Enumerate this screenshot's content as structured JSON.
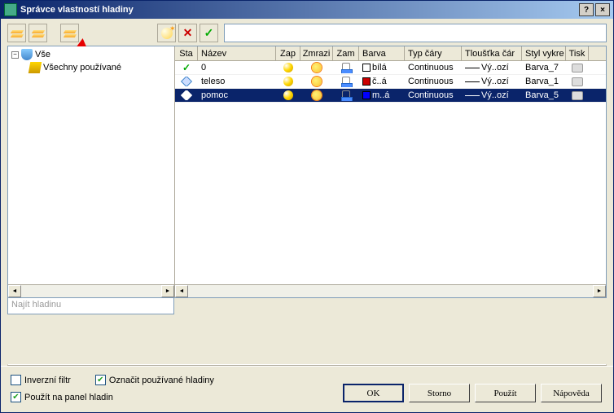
{
  "title": "Správce vlastností hladiny",
  "tree": {
    "root": "Vše",
    "child": "Všechny používané"
  },
  "filter_placeholder": "Najít hladinu",
  "columns": {
    "sta": "Sta",
    "name": "Název",
    "zap": "Zap",
    "zmraz": "Zmrazi",
    "zam": "Zam",
    "barva": "Barva",
    "typ": "Typ čáry",
    "tloust": "Tloušťka čár",
    "styl": "Styl vykre",
    "tisk": "Tisk"
  },
  "rows": [
    {
      "status": "check",
      "name": "0",
      "color_swatch": "white",
      "color": "bílá",
      "linetype": "Continuous",
      "lineweight": "Vý..ozí",
      "plotstyle": "Barva_7",
      "selected": false
    },
    {
      "status": "layer",
      "name": "teleso",
      "color_swatch": "red",
      "color": "č..á",
      "linetype": "Continuous",
      "lineweight": "Vý..ozí",
      "plotstyle": "Barva_1",
      "selected": false
    },
    {
      "status": "layer",
      "name": "pomoc",
      "color_swatch": "blue",
      "color": "m..á",
      "linetype": "Continuous",
      "lineweight": "Vý..ozí",
      "plotstyle": "Barva_5",
      "selected": true
    }
  ],
  "checkboxes": {
    "invert": {
      "label": "Inverzní filtr",
      "checked": false
    },
    "mark": {
      "label": "Označit používané hladiny",
      "checked": true
    },
    "panel": {
      "label": "Použít na panel hladin",
      "checked": true
    }
  },
  "buttons": {
    "ok": "OK",
    "storno": "Storno",
    "pouzit": "Použít",
    "napoveda": "Nápověda"
  }
}
